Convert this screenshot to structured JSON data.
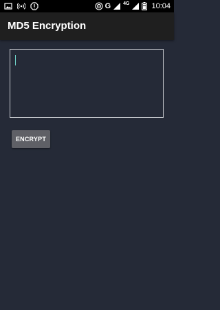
{
  "status_bar": {
    "network_type": "G",
    "network_gen": "4G",
    "time": "10:04",
    "icons": [
      "image-icon",
      "wifi-hotspot-icon",
      "alert-icon",
      "nfc-icon",
      "signal-icon",
      "battery-icon"
    ]
  },
  "app_bar": {
    "title": "MD5 Encryption"
  },
  "main": {
    "input_value": "",
    "encrypt_label": "ENCRYPT"
  },
  "colors": {
    "background": "#252a37",
    "app_bar": "#1f1f1f",
    "button": "#5f6066",
    "cursor": "#6fd3c9",
    "input_border": "#c9cbd0"
  }
}
